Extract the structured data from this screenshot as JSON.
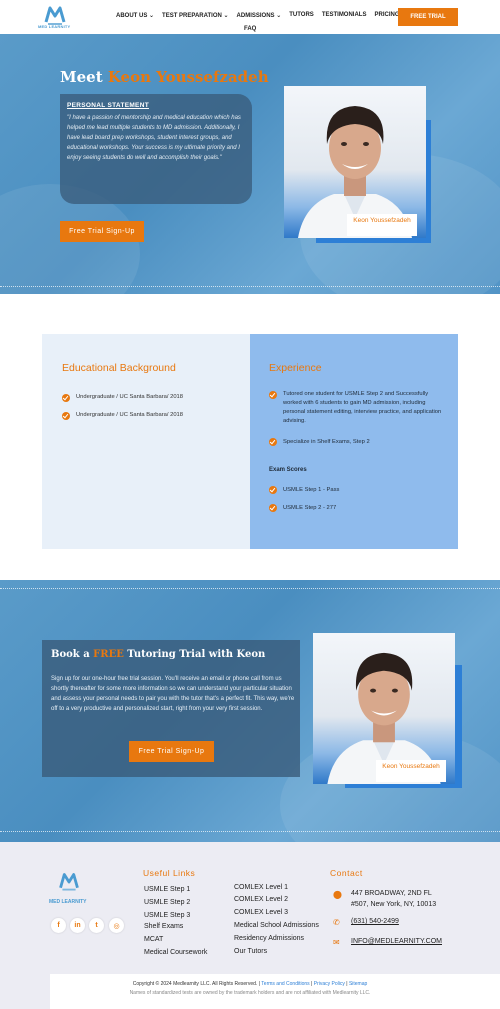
{
  "header": {
    "logo_text": "MED LEARNITY",
    "nav": [
      {
        "label": "ABOUT US",
        "dropdown": true
      },
      {
        "label": "TEST PREPARATION",
        "dropdown": true
      },
      {
        "label": "ADMISSIONS",
        "dropdown": true
      },
      {
        "label": "TUTORS",
        "dropdown": false
      },
      {
        "label": "TESTIMONIALS",
        "dropdown": false
      },
      {
        "label": "PRICING",
        "dropdown": false
      }
    ],
    "nav_faq": "FAQ",
    "trial_button": "FREE TRIAL"
  },
  "hero": {
    "title_prefix": "Meet ",
    "title_name": "Keon Youssefzadeh",
    "statement_heading": "PERSONAL STATEMENT",
    "statement_body": "\"I have a passion of mentorship and medical education which has helped me lead multiple students to MD admission. Additionally, I have lead board prep workshops, student interest groups, and educational workshops. Your success is my ultimate priority and I enjoy seeing students do well and accomplish their goals.\"",
    "signup_button": "Free Trial Sign-Up",
    "photo_caption": "Keon Youssefzadeh"
  },
  "education": {
    "title": "Educational Background",
    "items": [
      "Undergraduate / UC Santa Barbara/ 2018",
      "Undergraduate / UC Santa Barbara/ 2018"
    ]
  },
  "experience": {
    "title": "Experience",
    "items": [
      "Tutored one student for USMLE Step 2 and Successfully worked with 6 students to gain MD admission, including personal statement editing, interview practice, and application advising.",
      "Specialize in Shelf Exams, Step 2"
    ],
    "scores_heading": "Exam Scores",
    "scores": [
      "USMLE Step 1 - Pass",
      "USMLE Step 2 - 277"
    ]
  },
  "cta": {
    "title_prefix": "Book a ",
    "title_free": "FREE",
    "title_suffix": " Tutoring Trial with Keon",
    "body": "Sign up for our one-hour free trial session. You'll receive an email or phone call from us shortly thereafter for some more information so we can understand your particular situation and assess your personal needs to pair you with the tutor that's a perfect fit. This way, we're off to a very productive and personalized start, right from your very first session.",
    "signup_button": "Free Trial Sign-Up",
    "photo_caption": "Keon Youssefzadeh"
  },
  "footer": {
    "logo_text": "MED LEARNITY",
    "social": [
      {
        "icon": "facebook-icon",
        "glyph": "f"
      },
      {
        "icon": "linkedin-icon",
        "glyph": "in"
      },
      {
        "icon": "twitter-icon",
        "glyph": "t"
      },
      {
        "icon": "instagram-icon",
        "glyph": "◎"
      }
    ],
    "useful_links_heading": "Useful Links",
    "links_col1": [
      "USMLE Step 1",
      "USMLE Step 2",
      "USMLE Step 3",
      "Shelf Exams",
      "MCAT",
      "Medical Coursework"
    ],
    "links_col2": [
      "COMLEX Level 1",
      "COMLEX Level 2",
      "COMLEX Level 3",
      "Medical School Admissions",
      "Residency Admissions",
      "Our Tutors"
    ],
    "contact_heading": "Contact",
    "address": "447 BROADWAY, 2ND FL #507, New York, NY, 10013",
    "phone": "(631) 540-2499",
    "email": "INFO@MEDLEARNITY.COM",
    "copyright": "Copyright © 2024 Medlearnity LLC. All Rights Reserved.",
    "terms": "Terms and Conditions",
    "privacy": "Privacy Policy",
    "sitemap": "Sitemap",
    "disclaimer": "Names of standardized tests are owned by the trademark holders and are not affiliated with Medlearnity LLC."
  },
  "colors": {
    "accent": "#e8780f",
    "brand_blue": "#4a9bd1",
    "card_blue": "#8fbbed",
    "card_light": "#e8f0f9"
  }
}
